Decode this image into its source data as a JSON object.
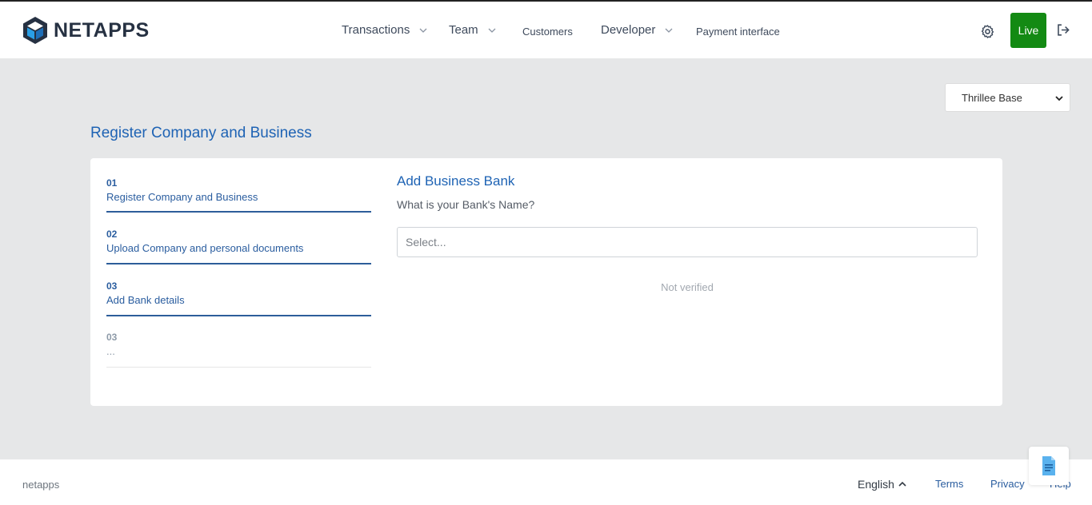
{
  "header": {
    "brand": "NETAPPS",
    "nav": [
      {
        "label": "Transactions",
        "has_dropdown": true
      },
      {
        "label": "Team",
        "has_dropdown": true
      },
      {
        "label": "Customers",
        "has_dropdown": false
      },
      {
        "label": "Developer",
        "has_dropdown": true
      },
      {
        "label": "Payment interface",
        "has_dropdown": false
      }
    ],
    "settings_icon": "gear-icon",
    "live_label": "Live",
    "logout_icon": "logout-icon"
  },
  "company_select": {
    "value": "Thrillee Base"
  },
  "page_title": "Register Company and Business",
  "steps": [
    {
      "number": "01",
      "label": "Register Company and Business",
      "active": true
    },
    {
      "number": "02",
      "label": "Upload Company and personal documents",
      "active": true
    },
    {
      "number": "03",
      "label": "Add Bank details",
      "active": true
    },
    {
      "number": "03",
      "label": "...",
      "active": false
    }
  ],
  "form": {
    "title": "Add Business Bank",
    "question": "What is your Bank's Name?",
    "bank_placeholder": "Select...",
    "status": "Not verified"
  },
  "footer": {
    "brand": "netapps",
    "language": "English",
    "links": [
      "Terms",
      "Privacy",
      "Help"
    ]
  },
  "colors": {
    "accent": "#1e63b4",
    "live": "#138a13",
    "background": "#e6e7e8"
  }
}
